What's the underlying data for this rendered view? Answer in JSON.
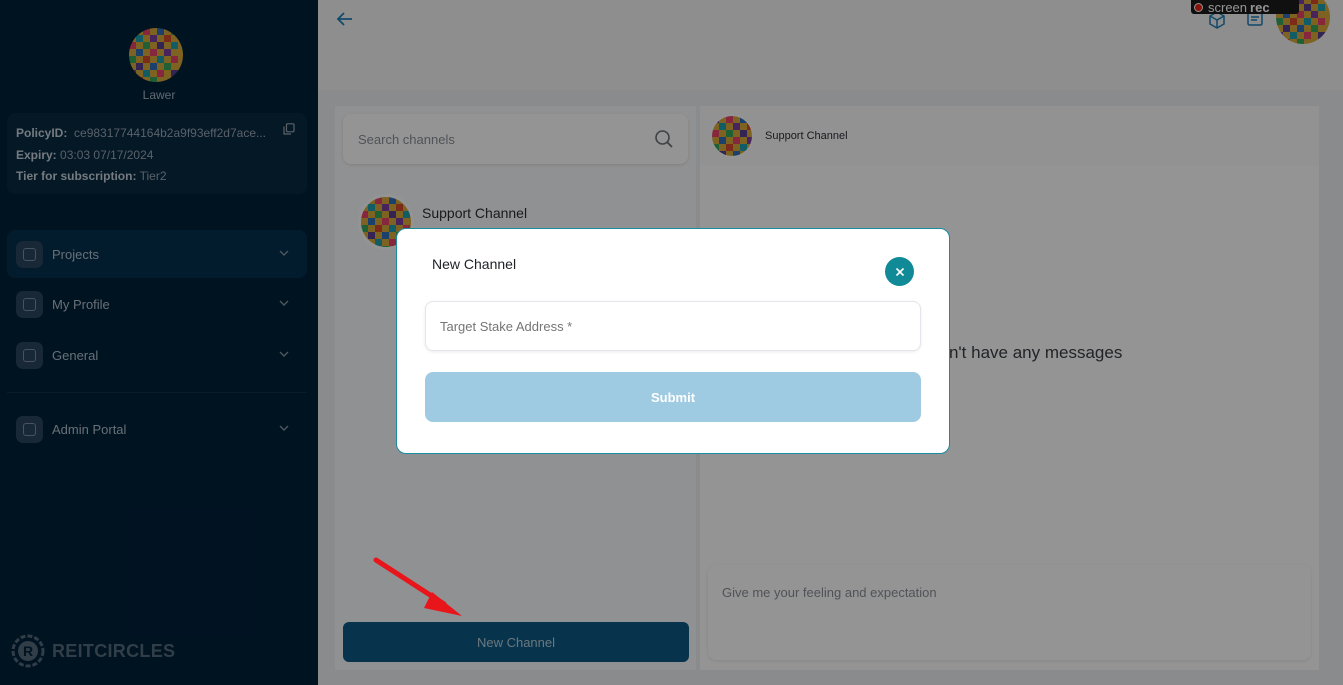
{
  "sidebar": {
    "user_name": "Lawer",
    "policy": {
      "policy_label": "PolicyID:",
      "policy_value": "ce98317744164b2a9f93eff2d7ace...",
      "expiry_label": "Expiry:",
      "expiry_value": "03:03 07/17/2024",
      "tier_label": "Tier for subscription:",
      "tier_value": "Tier2"
    },
    "items": [
      {
        "label": "Projects"
      },
      {
        "label": "My Profile"
      },
      {
        "label": "General"
      },
      {
        "label": "Admin Portal"
      }
    ],
    "logo_text": "REITCIRCLES"
  },
  "header": {
    "recorder_text_1": "screen",
    "recorder_text_2": "rec"
  },
  "channels": {
    "search_placeholder": "Search channels",
    "items": [
      {
        "name": "Support Channel"
      }
    ],
    "new_channel_label": "New Channel"
  },
  "chat": {
    "channel_name": "Support Channel",
    "empty_message": "You don't have any messages",
    "input_placeholder": "Give me your feeling and expectation"
  },
  "modal": {
    "title": "New Channel",
    "field_placeholder": "Target Stake Address *",
    "submit_label": "Submit"
  },
  "colors": {
    "sidebar_bg": "#01213a",
    "accent": "#0f8a96",
    "button_bg": "#0d5a83",
    "submit_disabled": "#9ecbe2",
    "annotation_arrow": "#e8151b"
  }
}
